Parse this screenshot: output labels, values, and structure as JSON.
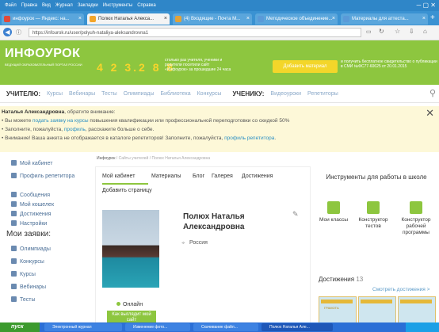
{
  "menubar": {
    "items": [
      "Файл",
      "Правка",
      "Вид",
      "Журнал",
      "Закладки",
      "Инструменты",
      "Справка"
    ]
  },
  "tabs": [
    {
      "label": "инфоурок — Яндекс: на...",
      "color": "#e04a3a"
    },
    {
      "label": "Полюх Наталья Алекса...",
      "color": "#8dc63f"
    },
    {
      "label": "(4) Входящие - Почта М...",
      "color": "#e0a23a"
    },
    {
      "label": "Методическое объединение...",
      "color": "#5a9ad8"
    },
    {
      "label": "Материалы для аттеста...",
      "color": "#5a9ad8"
    }
  ],
  "address": {
    "url": "https://infourok.ru/user/polyuh-nataliya-aleksandrovna1"
  },
  "header": {
    "logo": "ИНФОУРОК",
    "logo_sub": "ВЕДУЩИЙ ОБРАЗОВАТЕЛЬНЫЙ ПОРТАЛ РОССИИ",
    "counter": "4 2 3.2 8 8",
    "counter_desc": "столько раз учителя, ученики и родители посетили сайт «Инфоурок» за прошедшие 24 часа",
    "add_button": "Добавить материал",
    "cert_info": "и получить бесплатное свидетельство о публикации в СМИ №ФС77-60625 от 20.01.2015"
  },
  "nav": {
    "teacher": "УЧИТЕЛЮ:",
    "teacher_items": [
      "Курсы",
      "Вебинары",
      "Тесты",
      "Олимпиады",
      "Библиотека",
      "Конкурсы"
    ],
    "student": "УЧЕНИКУ:",
    "student_items": [
      "Видеоуроки",
      "Репетиторы"
    ]
  },
  "notice": {
    "name": "Наталья Александровна",
    "intro": ", обратите внимание:",
    "line1_pre": "Вы можете ",
    "line1_link": "подать заявку на курсы",
    "line1_post": " повышения квалификации или профессиональной переподготовки со скидкой 50%",
    "line2_pre": "Заполните, пожалуйста, ",
    "line2_link": "профиль",
    "line2_post": ", расскажите больше о себе.",
    "line3_pre": "Внимание! Ваша анкета не отображается в каталоге репетиторов! Заполните, пожалуйста, ",
    "line3_link": "профиль репетитора",
    "line3_post": "."
  },
  "sidebar": {
    "items": [
      "Мой кабинет",
      "Профиль репетитора",
      "Сообщения",
      "Мой кошелек",
      "Достижения",
      "Настройки"
    ],
    "applications_title": "Мои заявки:",
    "applications": [
      "Олимпиады",
      "Конкурсы",
      "Курсы",
      "Вебинары",
      "Тесты"
    ]
  },
  "breadcrumb": {
    "a": "Инфоурок",
    "b": "Сайты учителей",
    "c": "Полюх Наталья Александровна"
  },
  "profile": {
    "tabs": [
      "Мой кабинет",
      "Материалы",
      "Блог",
      "Галерея",
      "Достижения"
    ],
    "add_page": "Добавить страницу",
    "name": "Полюх Наталья Александровна",
    "country": "Россия",
    "online": "Онлайн",
    "view_button": "Как выглядит мой сайт"
  },
  "tools": {
    "title": "Инструменты для работы в школе",
    "items": [
      "Мои классы",
      "Конструктор тестов",
      "Конструктор рабочей программы"
    ],
    "achievements_label": "Достижения",
    "achievements_count": "13",
    "see_all": "Смотреть достижения >",
    "cert_label": "ГРАМОТА"
  },
  "taskbar": {
    "start": "пуск",
    "items": [
      "Электронный журнал",
      "Изменение фото...",
      "Скачивание файл...",
      "Полюх Наталья Але..."
    ]
  },
  "colors": {
    "brand_green": "#8dc63f",
    "accent_yellow": "#f3d62a",
    "link_blue": "#2a8fc4",
    "titlebar": "#2f86c8"
  }
}
